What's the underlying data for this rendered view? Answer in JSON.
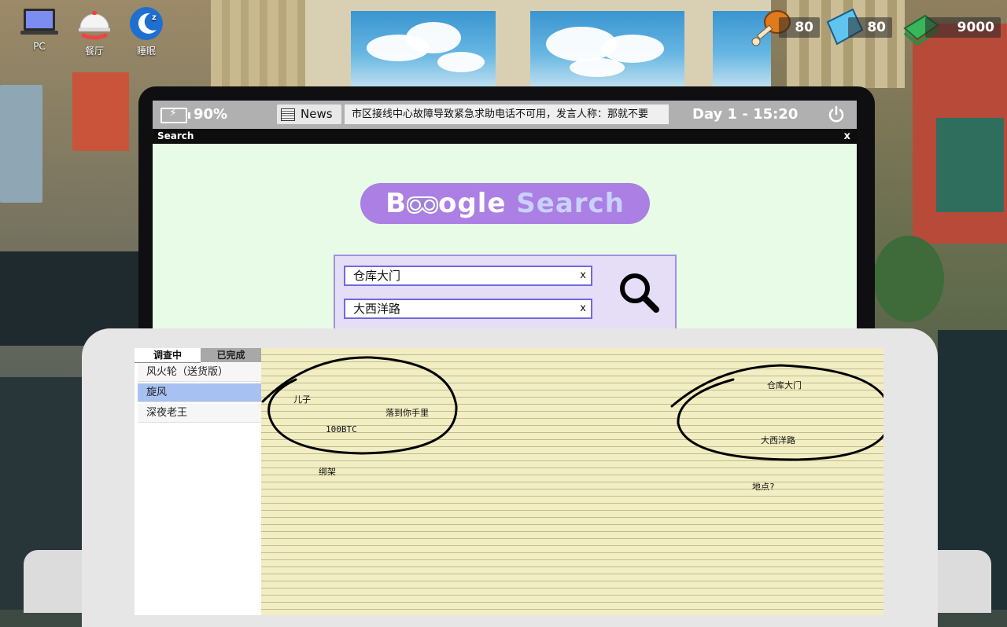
{
  "hud": {
    "apps": [
      {
        "label": "PC",
        "icon": "laptop-icon"
      },
      {
        "label": "餐厅",
        "icon": "cloche-icon"
      },
      {
        "label": "睡眠",
        "icon": "moon-sleep-icon"
      }
    ],
    "resources": {
      "food": {
        "value": "80",
        "icon": "chicken-leg-icon"
      },
      "rest": {
        "value": "80",
        "icon": "pillow-icon"
      },
      "money": {
        "value": "9000",
        "icon": "cash-icon"
      }
    }
  },
  "os_bar": {
    "battery": "90%",
    "news_label": "News",
    "ticker": "市区接线中心故障导致紧急求助电话不可用，发言人称：那就不要",
    "day_time": "Day 1 - 15:20"
  },
  "search_window": {
    "title": "Search",
    "close": "x",
    "logo_part1": "B",
    "logo_part2": "ogle",
    "logo_part3": "Search",
    "field1": "仓库大门",
    "field2": "大西洋路",
    "clear": "x"
  },
  "case_panel": {
    "tabs": [
      "调查中",
      "已完成"
    ],
    "cases": [
      "风火轮（送货版）",
      "旋风",
      "深夜老王"
    ],
    "selected_index": 1
  },
  "notes": {
    "words": [
      "儿子",
      "落到你手里",
      "100BTC",
      "绑架",
      "仓库大门",
      "大西洋路",
      "地点?"
    ]
  },
  "colors": {
    "screen_bg": "#e7fbe6",
    "logo_bg": "#ab7fe3",
    "selected_case": "#a8c1f3",
    "notepad": "#f2eec4"
  }
}
